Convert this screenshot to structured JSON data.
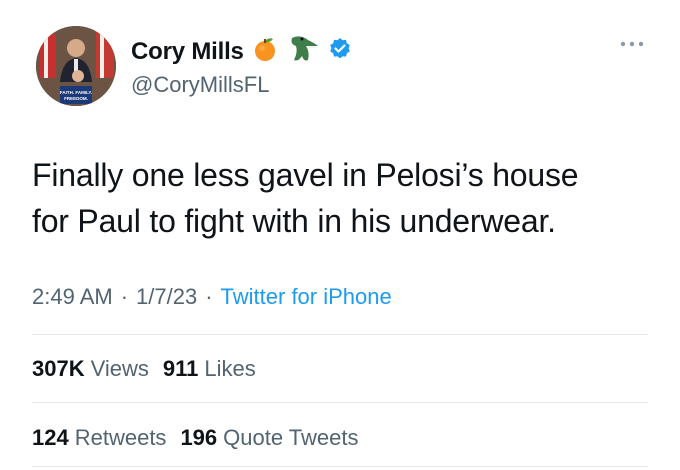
{
  "user": {
    "name": "Cory Mills",
    "handle": "@CoryMillsFL",
    "badges": [
      "orange-emoji",
      "alligator-emoji",
      "verified-badge"
    ],
    "avatar_sign_text": "FAITH. FAMILY. FREEDOM."
  },
  "tweet": {
    "lines": [
      "Finally one less gavel in Pelosi’s house",
      "for Paul to fight with in his underwear."
    ]
  },
  "meta": {
    "time": "2:49 AM",
    "date": "1/7/23",
    "source": "Twitter for iPhone",
    "separator": "·"
  },
  "stats": {
    "views_count": "307K",
    "views_label": "Views",
    "likes_count": "911",
    "likes_label": "Likes",
    "retweets_count": "124",
    "retweets_label": "Retweets",
    "quotes_count": "196",
    "quotes_label": "Quote Tweets"
  },
  "colors": {
    "link": "#1d9bf0",
    "secondary_text": "#536471",
    "primary_text": "#0f1419",
    "divider": "#e7e9ea"
  }
}
